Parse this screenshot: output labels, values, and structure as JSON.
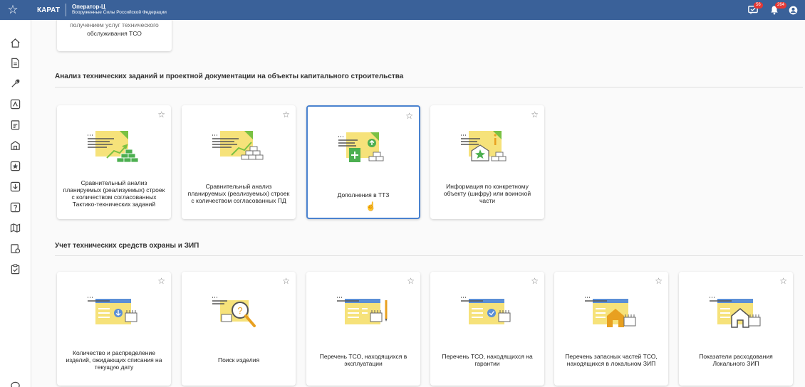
{
  "topbar": {
    "app_name": "КАРАТ",
    "org_title": "Оператор-Ц",
    "org_subtitle": "Вооруженные Силы Российской Федерации",
    "messages_badge": "56",
    "notifications_badge": "264"
  },
  "partial_card": {
    "line1": "получением услуг технического",
    "line2": "обслуживания ТСО"
  },
  "sections": [
    {
      "title": "Анализ технических заданий и проектной документации на объекты капитального строительства",
      "cards": [
        {
          "label": "Сравнительный анализ планируемых (реализуемых) строек с количеством согласованных Тактико-технических заданий",
          "icon": "chart-doc-icon"
        },
        {
          "label": "Сравнительный анализ планируемых (реализуемых) строек с количеством согласованных ПД",
          "icon": "chart-doc-icon"
        },
        {
          "label": "Дополнения в ТТЗ",
          "icon": "doc-add-icon"
        },
        {
          "label": "Информация по конкретному объекту (шифру) или воинской части",
          "icon": "doc-info-icon"
        }
      ]
    },
    {
      "title": "Учет технических средств охраны и ЗИП",
      "cards": [
        {
          "label": "Количество и распределение изделий, ожидающих списания на текущую дату",
          "icon": "doc-down-icon"
        },
        {
          "label": "Поиск изделия",
          "icon": "doc-search-icon"
        },
        {
          "label": "Перечень ТСО, находящихся в эксплуатации",
          "icon": "doc-pen-icon"
        },
        {
          "label": "Перечень ТСО, находящихся на гарантии",
          "icon": "doc-check-icon"
        },
        {
          "label": "Перечень запасных частей ТСО, находящихся в локальном ЗИП",
          "icon": "doc-house-icon"
        },
        {
          "label": "Показатели расходования Локального ЗИП",
          "icon": "doc-house-outline-icon"
        }
      ]
    }
  ],
  "colors": {
    "topbar": "#3a6199",
    "accent_border": "#4a82cf",
    "illustration_yellow": "#f6e27a",
    "illustration_green": "#4caf50"
  }
}
